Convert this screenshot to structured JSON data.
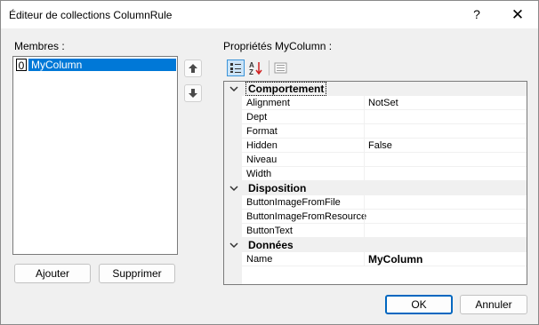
{
  "window": {
    "title": "Éditeur de collections ColumnRule",
    "help_glyph": "?",
    "close_glyph": "✕"
  },
  "members": {
    "label": "Membres :",
    "items": [
      {
        "index": "0",
        "name": "MyColumn",
        "selected": true
      }
    ],
    "move_up_icon": "arrow-up-icon",
    "move_down_icon": "arrow-down-icon",
    "add_label": "Ajouter",
    "remove_label": "Supprimer"
  },
  "properties": {
    "label": "Propriétés MyColumn :",
    "toolbar": [
      "categorized-icon",
      "alphabetical-icon",
      "property-pages-icon"
    ],
    "categories": [
      {
        "name": "Comportement",
        "props": [
          {
            "name": "Alignment",
            "value": "NotSet"
          },
          {
            "name": "Dept",
            "value": ""
          },
          {
            "name": "Format",
            "value": ""
          },
          {
            "name": "Hidden",
            "value": "False"
          },
          {
            "name": "Niveau",
            "value": ""
          },
          {
            "name": "Width",
            "value": ""
          }
        ]
      },
      {
        "name": "Disposition",
        "props": [
          {
            "name": "ButtonImageFromFile",
            "value": ""
          },
          {
            "name": "ButtonImageFromResource",
            "value": ""
          },
          {
            "name": "ButtonText",
            "value": ""
          }
        ]
      },
      {
        "name": "Données",
        "props": [
          {
            "name": "Name",
            "value": "MyColumn",
            "bold": true
          }
        ]
      }
    ]
  },
  "footer": {
    "ok_label": "OK",
    "cancel_label": "Annuler"
  }
}
